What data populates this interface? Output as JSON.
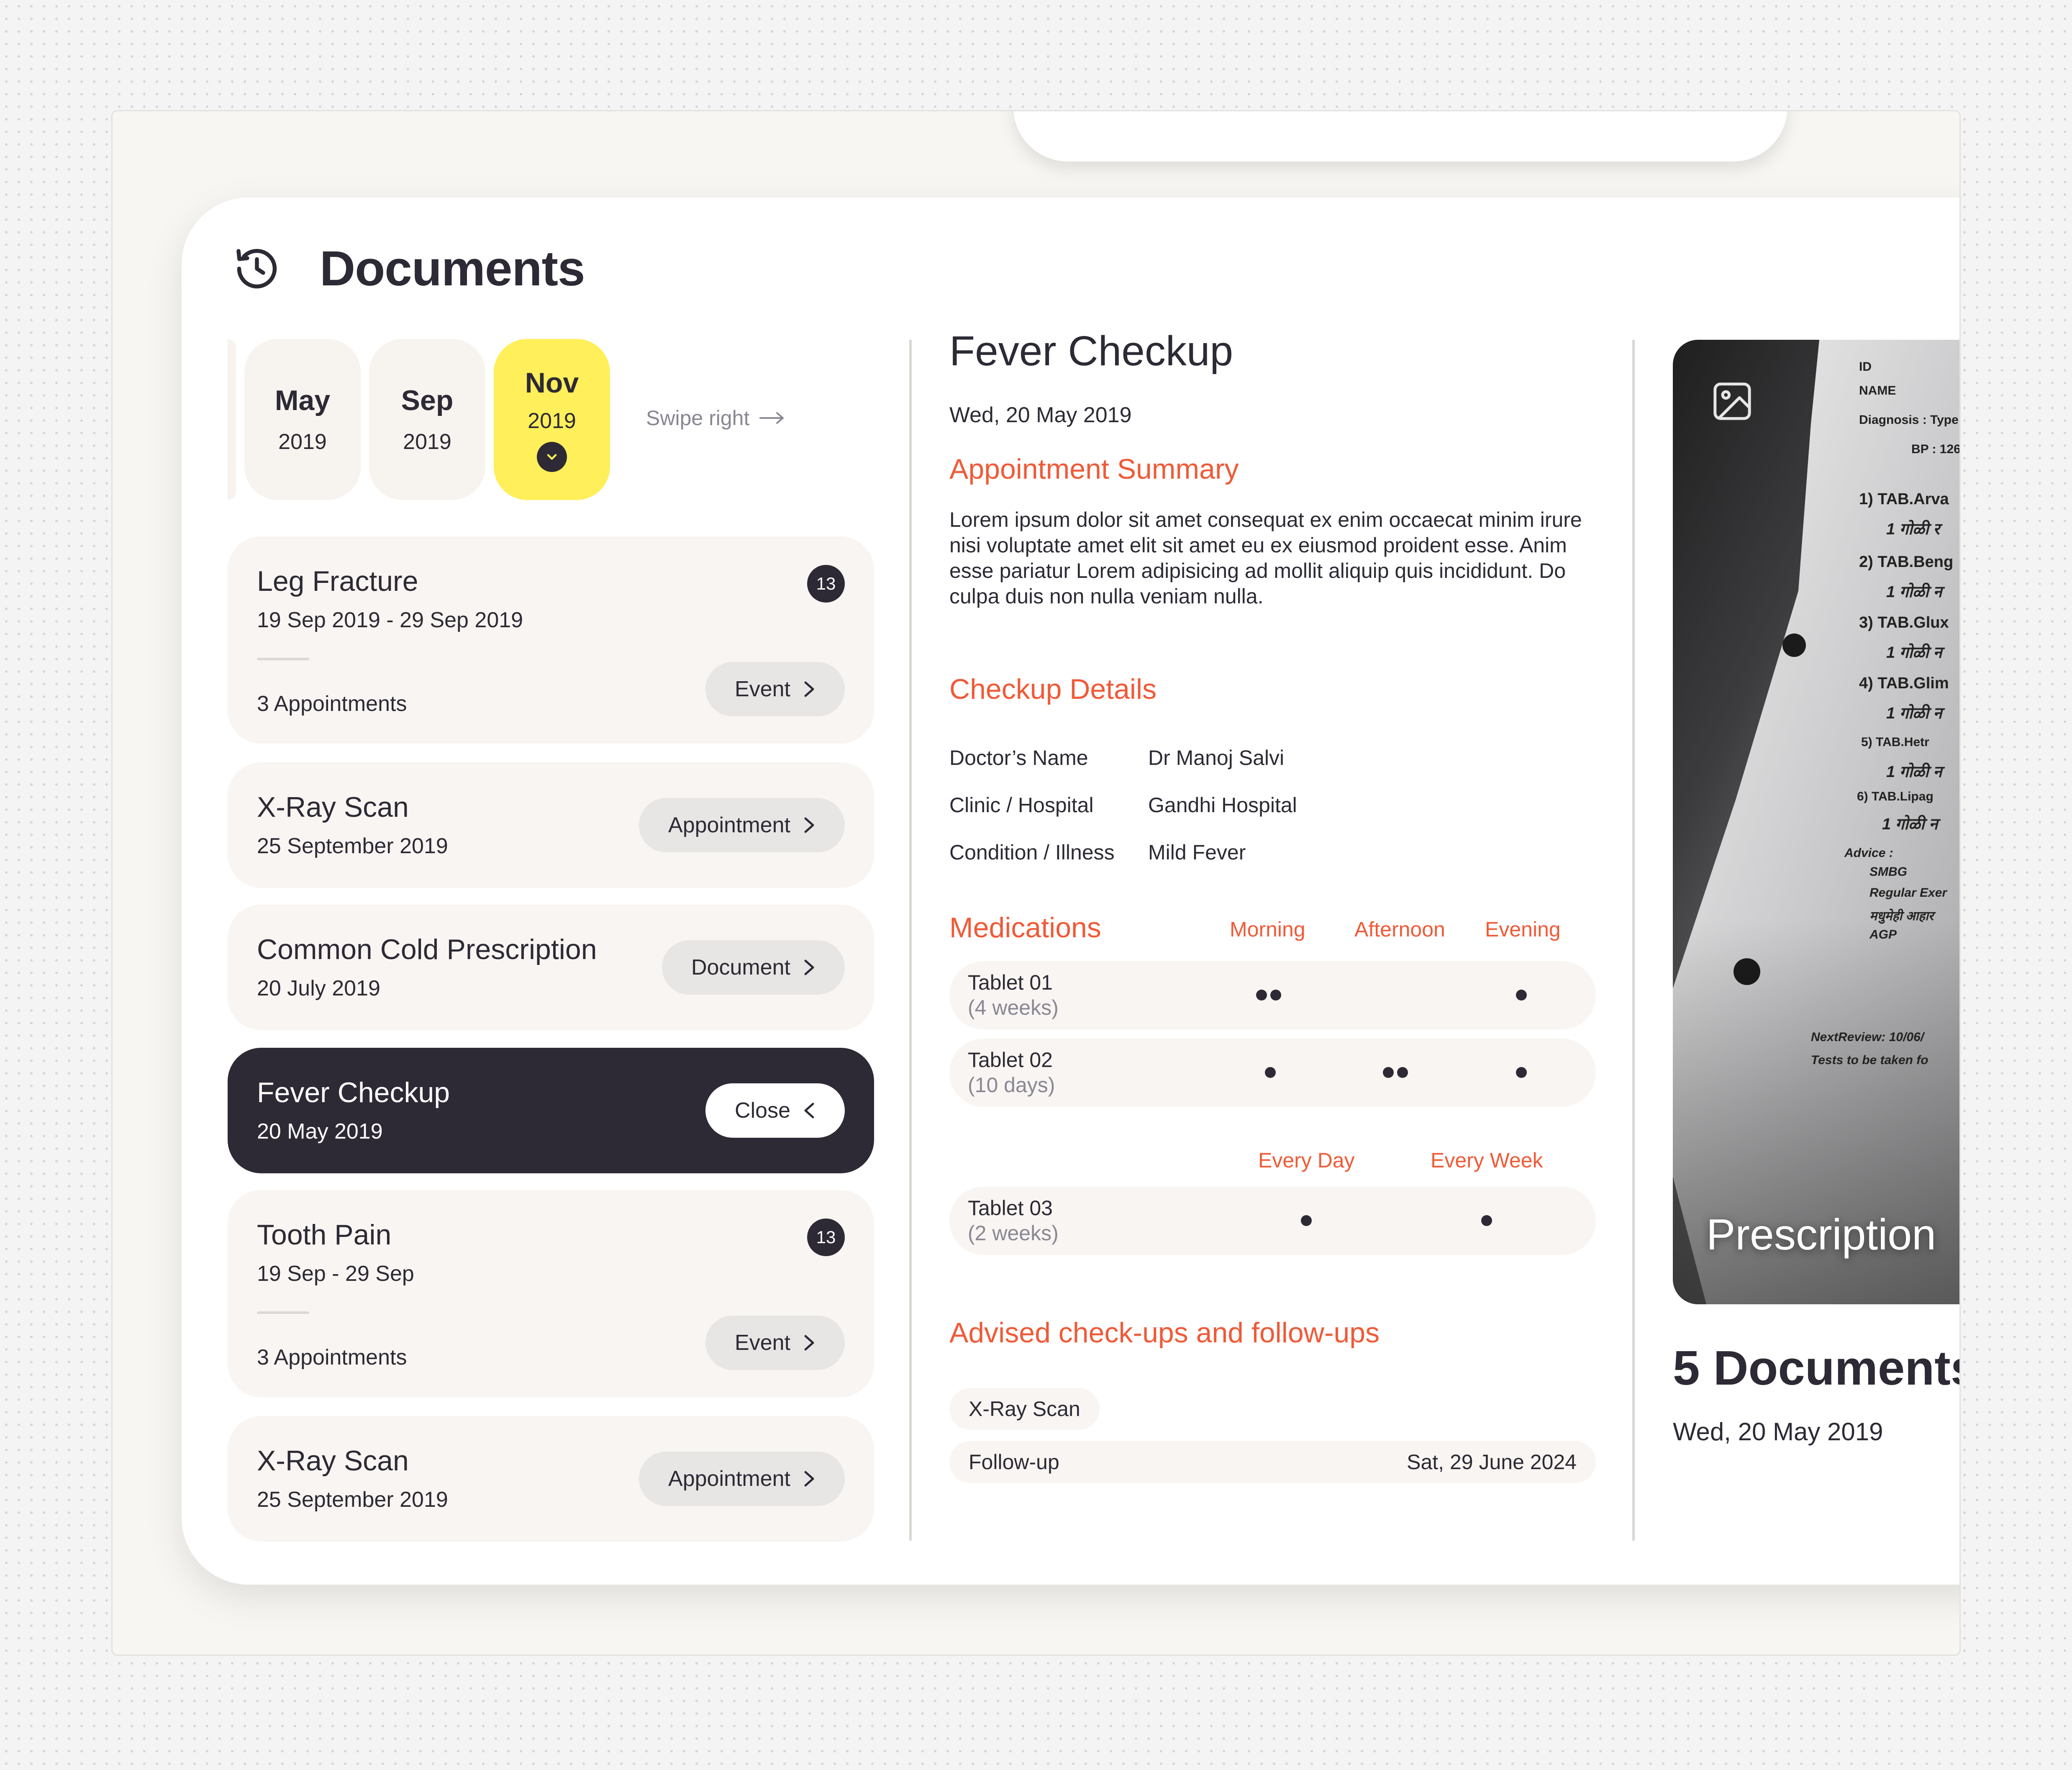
{
  "header": {
    "title": "Documents",
    "icon": "history-icon"
  },
  "months": [
    {
      "name": "May",
      "year": "2019"
    },
    {
      "name": "Sep",
      "year": "2019"
    },
    {
      "name": "Nov",
      "year": "2019",
      "active": true
    }
  ],
  "swipe_label": "Swipe right",
  "list": [
    {
      "title": "Leg Fracture",
      "date": "19 Sep 2019 - 29 Sep 2019",
      "badge": "13",
      "count": "3 Appointments",
      "action": "Event"
    },
    {
      "title": "X-Ray Scan",
      "date": "25 September 2019",
      "action": "Appointment"
    },
    {
      "title": "Common Cold Prescription",
      "date": "20 July 2019",
      "action": "Document"
    },
    {
      "title": "Fever Checkup",
      "date": "20 May 2019",
      "action": "Close",
      "selected": true
    },
    {
      "title": "Tooth Pain",
      "date": "19 Sep - 29 Sep",
      "badge": "13",
      "count": "3 Appointments",
      "action": "Event"
    },
    {
      "title": "X-Ray Scan",
      "date": "25 September 2019",
      "action": "Appointment"
    }
  ],
  "detail": {
    "title": "Fever Checkup",
    "date": "Wed, 20 May 2019",
    "summary_heading": "Appointment Summary",
    "summary": "Lorem ipsum dolor sit amet consequat ex enim occaecat minim irure nisi voluptate amet elit sit amet eu ex eiusmod proident esse. Anim esse pariatur Lorem adipisicing ad mollit aliquip quis incididunt. Do culpa duis non nulla veniam nulla.",
    "checkup_heading": "Checkup Details",
    "checkup": [
      {
        "key": "Doctor’s Name",
        "value": "Dr Manoj Salvi"
      },
      {
        "key": "Clinic / Hospital",
        "value": "Gandhi Hospital"
      },
      {
        "key": "Condition / Illness",
        "value": "Mild Fever"
      }
    ],
    "medications_heading": "Medications",
    "dose_columns": [
      "Morning",
      "Afternoon",
      "Evening"
    ],
    "medications": [
      {
        "name": "Tablet 01",
        "duration": "(4 weeks)",
        "morning": 2,
        "afternoon": 0,
        "evening": 1
      },
      {
        "name": "Tablet 02",
        "duration": "(10 days)",
        "morning": 1,
        "afternoon": 2,
        "evening": 1
      }
    ],
    "frequency_columns": [
      "Every Day",
      "Every Week"
    ],
    "frequency_medications": [
      {
        "name": "Tablet 03",
        "duration": "(2 weeks)",
        "every_day": 1,
        "every_week": 1
      }
    ],
    "followups_heading": "Advised check-ups and follow-ups",
    "followups": [
      {
        "label": "X-Ray Scan"
      },
      {
        "label": "Follow-up",
        "date": "Sat, 29 June 2024"
      }
    ]
  },
  "preview": {
    "label": "Prescription",
    "count": "5 Documents",
    "date": "Wed, 20 May 2019",
    "paper_lines": [
      "ID",
      "NAME",
      "Diagnosis : Type",
      "BP : 126",
      "1) TAB.Arva",
      "1 गोळी र",
      "2) TAB.Beng",
      "1 गोळी न",
      "3) TAB.Glux",
      "1 गोळी न",
      "4) TAB.Glim",
      "1 गोळी न",
      "5) TAB.Hetr",
      "1 गोळी न",
      "6) TAB.Lipag",
      "1 गोळी न",
      "Advice :",
      "SMBG",
      "Regular Exer",
      "मधुमेही आहार",
      "AGP",
      "NextReview: 10/06/",
      "Tests to be taken fo"
    ]
  },
  "colors": {
    "accent": "#f05a37",
    "dark": "#2d2a35",
    "highlight": "#ffef5a",
    "card": "#f8f5f2"
  }
}
